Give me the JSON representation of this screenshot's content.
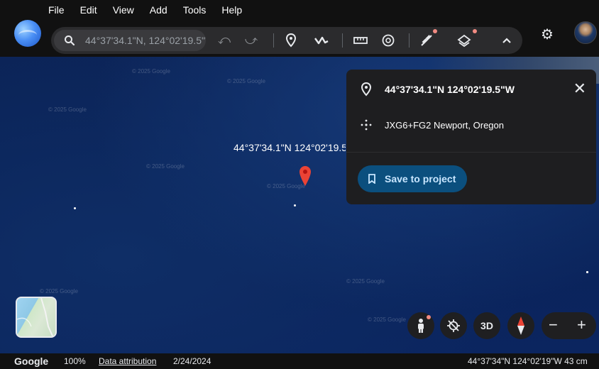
{
  "menu": [
    "File",
    "Edit",
    "View",
    "Add",
    "Tools",
    "Help"
  ],
  "search": {
    "value": "44°37'34.1\"N, 124°02'19.5\"W"
  },
  "icons": {
    "search": "search-icon",
    "undo": "undo-icon",
    "redo": "redo-icon",
    "placemark": "placemark-icon",
    "path": "path-icon",
    "ruler": "ruler-icon",
    "history": "history-icon",
    "voyager": "voyager-icon",
    "layers": "layers-icon",
    "collapse": "chevron-up-icon",
    "settings": "gear-icon"
  },
  "map": {
    "label": "44°37'34.1\"N 124°02'19.5\"W",
    "watermark": "© 2025 Google"
  },
  "panel": {
    "title": "44°37'34.1\"N 124°02'19.5\"W",
    "plus_code": "JXG6+FG2 Newport, Oregon",
    "save_label": "Save to project"
  },
  "controls": {
    "view3d": "3D",
    "zoom_out": "−",
    "zoom_in": "+"
  },
  "status": {
    "brand": "Google",
    "zoom": "100%",
    "attribution": "Data attribution",
    "date": "2/24/2024",
    "coords": "44°37'34\"N 124°02'19\"W  43 cm"
  },
  "colors": {
    "accent": "#0b4f7e",
    "pin": "#ea4335",
    "badge": "#f28b82"
  }
}
